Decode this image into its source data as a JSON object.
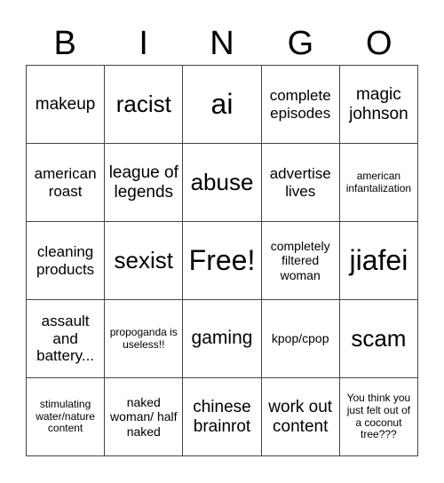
{
  "header": [
    "B",
    "I",
    "N",
    "G",
    "O"
  ],
  "cells": [
    [
      "makeup",
      "racist",
      "ai",
      "complete episodes",
      "magic johnson"
    ],
    [
      "american roast",
      "league of legends",
      "abuse",
      "advertise lives",
      "american infantalization"
    ],
    [
      "cleaning products",
      "sexist",
      "Free!",
      "completely filtered woman",
      "jiafei"
    ],
    [
      "assault and battery...",
      "propoganda is useless!!",
      "gaming",
      "kpop/cpop",
      "scam"
    ],
    [
      "stimulating water/nature content",
      "naked woman/ half naked",
      "chinese brainrot",
      "work out content",
      "You think you just felt out of a coconut tree???"
    ]
  ]
}
